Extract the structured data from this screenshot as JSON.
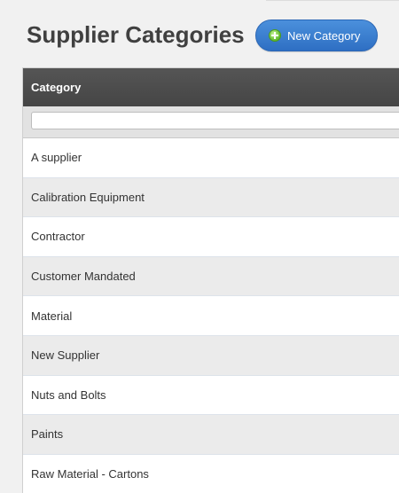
{
  "header": {
    "title": "Supplier Categories",
    "new_button_label": "New Category"
  },
  "table": {
    "column_header": "Category",
    "filter_value": "",
    "rows": [
      "A supplier",
      "Calibration Equipment",
      "Contractor",
      "Customer Mandated",
      "Material",
      "New Supplier",
      "Nuts and Bolts",
      "Paints",
      "Raw Material - Cartons"
    ]
  },
  "colors": {
    "accent": "#3a7fd0",
    "header_bg": "#4d4d4d",
    "alt_row": "#ebebeb"
  }
}
